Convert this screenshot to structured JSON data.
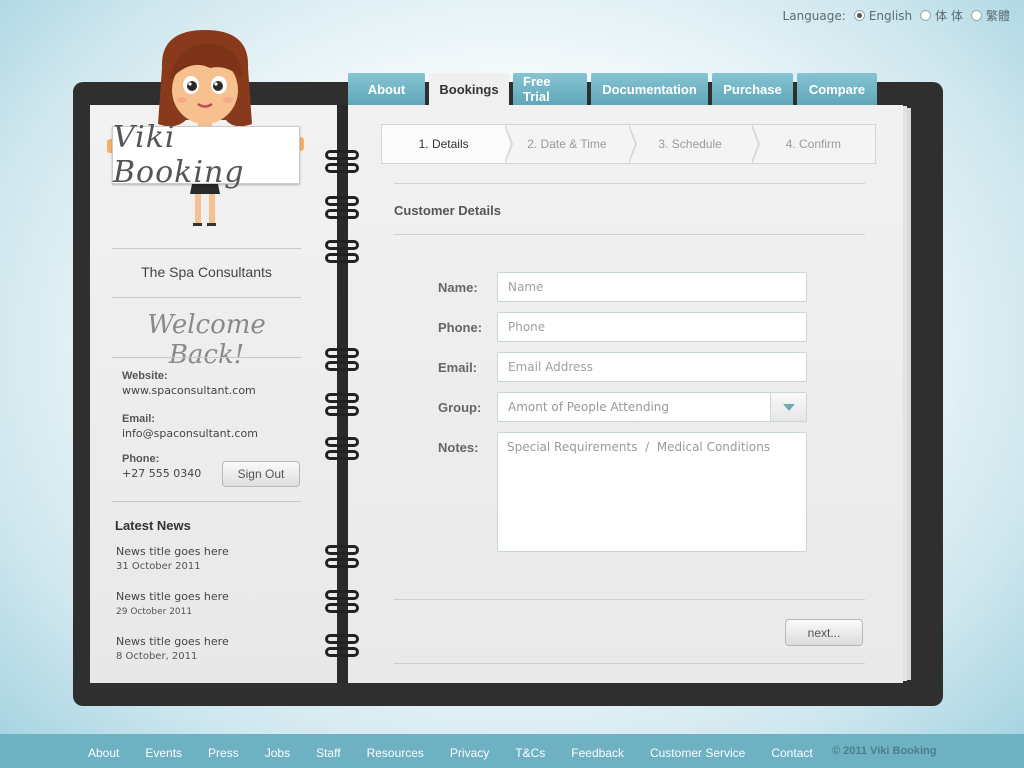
{
  "language": {
    "label": "Language:",
    "options": [
      "English",
      "体 体",
      "繁體"
    ],
    "selected": "English"
  },
  "tabs": [
    "About",
    "Bookings",
    "Free Trial",
    "Documentation",
    "Purchase",
    "Compare"
  ],
  "active_tab": "Bookings",
  "brand": {
    "sign_text": "Viki Booking"
  },
  "sidebar": {
    "company": "The Spa Consultants",
    "welcome": "Welcome Back!",
    "website_label": "Website:",
    "website": "www.spaconsultant.com",
    "email_label": "Email:",
    "email": "info@spaconsultant.com",
    "phone_label": "Phone:",
    "phone": "+27 555 0340",
    "signout": "Sign Out",
    "news_heading": "Latest News",
    "news": [
      {
        "title": "News title goes here",
        "date": "31 October 2011"
      },
      {
        "title": "News title goes here",
        "date": "29 October 2011"
      },
      {
        "title": "News title goes here",
        "date": "8 October, 2011"
      }
    ]
  },
  "steps": [
    "1. Details",
    "2. Date & Time",
    "3. Schedule",
    "4. Confirm"
  ],
  "active_step": "1. Details",
  "form": {
    "section_title": "Customer Details",
    "name_label": "Name:",
    "name_placeholder": "Name",
    "phone_label": "Phone:",
    "phone_placeholder": "Phone",
    "email_label": "Email:",
    "email_placeholder": "Email Address",
    "group_label": "Group:",
    "group_value": "Amont of People Attending",
    "notes_label": "Notes:",
    "notes_placeholder": "Special Requirements  /  Medical Conditions",
    "next": "next..."
  },
  "footer": {
    "links": [
      "About",
      "Events",
      "Press",
      "Jobs",
      "Staff",
      "Resources",
      "Privacy",
      "T&Cs",
      "Feedback",
      "Customer Service",
      "Contact"
    ],
    "copyright": "© 2011 Viki Booking"
  },
  "colors": {
    "tab": "#6fb2c4",
    "footer": "#6db1c2",
    "book": "#2f2f2f"
  }
}
